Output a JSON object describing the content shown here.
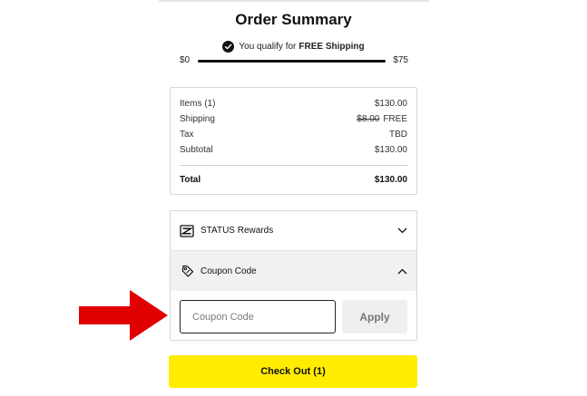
{
  "order_summary": {
    "title": "Order Summary",
    "qualify_prefix": "You qualify for",
    "qualify_bold": "FREE Shipping",
    "progress": {
      "min_label": "$0",
      "max_label": "$75",
      "fill_fraction": 1.0
    },
    "rows": [
      {
        "label": "Items (1)",
        "value": "$130.00"
      },
      {
        "label": "Shipping",
        "strike": "$8.00",
        "value": "FREE"
      },
      {
        "label": "Tax",
        "value": "TBD"
      },
      {
        "label": "Subtotal",
        "value": "$130.00"
      }
    ],
    "total": {
      "label": "Total",
      "value": "$130.00"
    }
  },
  "accordion": {
    "status_label": "STATUS Rewards",
    "coupon_label": "Coupon Code",
    "coupon_placeholder": "Coupon Code",
    "coupon_value": "",
    "apply_label": "Apply"
  },
  "checkout_label": "Check Out (1)",
  "colors": {
    "checkout_bg": "#ffec00",
    "arrow": "#e00000",
    "apply_bg": "#efefef"
  },
  "icons": {
    "qualify": "check-circle-icon",
    "status": "status-rewards-icon",
    "coupon": "coupon-tag-icon",
    "status_toggle": "chevron-down-icon",
    "coupon_toggle": "chevron-up-icon",
    "annotation": "arrow-right-icon"
  }
}
